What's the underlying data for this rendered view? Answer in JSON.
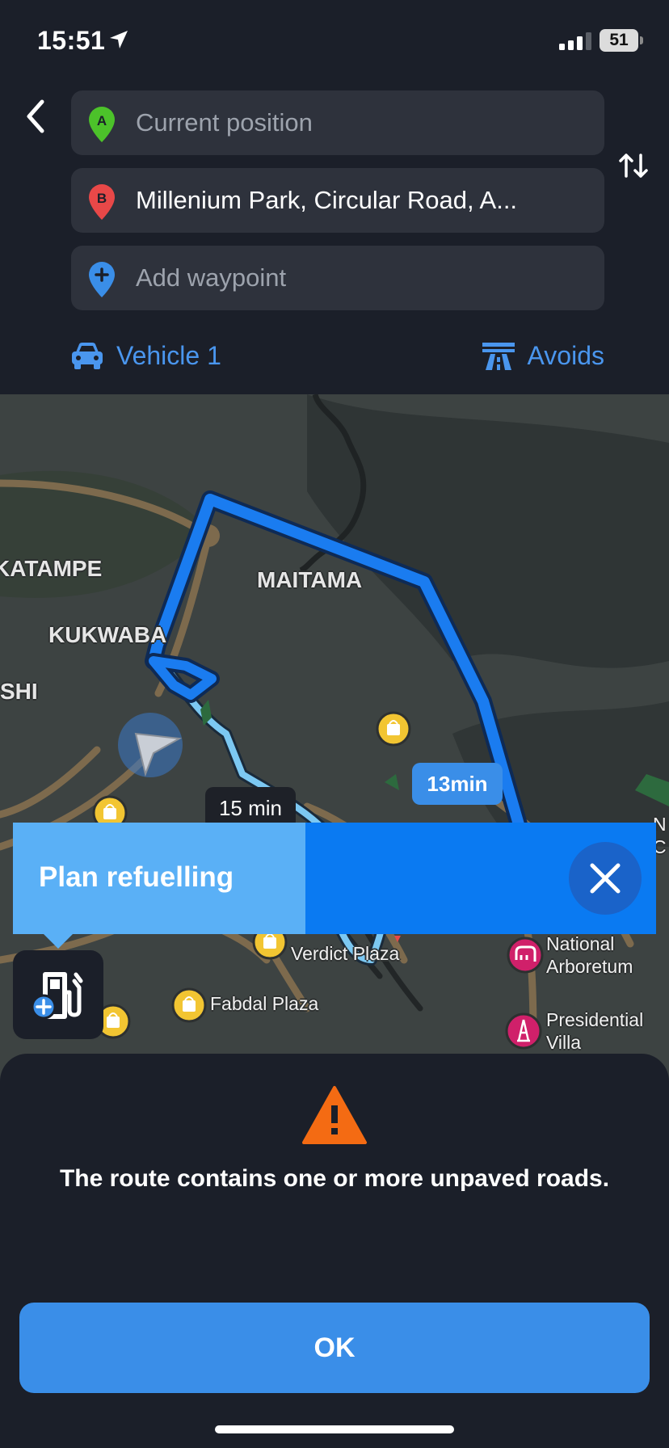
{
  "status_bar": {
    "time": "15:51",
    "battery": "51"
  },
  "route": {
    "origin": {
      "pin_letter": "A",
      "text": "Current position",
      "pin_color": "#4cc22a"
    },
    "destination": {
      "pin_letter": "B",
      "text": "Millenium Park, Circular Road, A...",
      "pin_color": "#e84848"
    },
    "waypoint": {
      "placeholder": "Add waypoint",
      "pin_color": "#3a8ee8"
    }
  },
  "options": {
    "vehicle_label": "Vehicle 1",
    "avoids_label": "Avoids"
  },
  "map": {
    "areas": [
      "KATAMPE",
      "MAITAMA",
      "KUKWABA",
      "SHI"
    ],
    "route_times": {
      "alternative": "15 min",
      "primary": "13min"
    },
    "pois": [
      "Verdict Plaza",
      "National\nArboretum",
      "Fabdal Plaza",
      "Presidential\nVilla"
    ],
    "edge_letters": "N\nC"
  },
  "refuel": {
    "label": "Plan refuelling"
  },
  "sheet": {
    "warning": "The route contains one or more unpaved roads.",
    "ok_label": "OK"
  },
  "colors": {
    "accent": "#3a8ee8",
    "route": "#1a7cf0",
    "warning": "#f46b13",
    "background": "#1b1f29"
  },
  "icons": [
    "location-arrow-icon",
    "signal-icon",
    "battery-icon",
    "back-arrow-icon",
    "swap-icon",
    "car-icon",
    "highway-icon",
    "close-icon",
    "fuel-plus-icon",
    "warning-icon",
    "shopping-bag-icon",
    "elephant-icon",
    "eiffel-icon",
    "navigation-arrow-icon"
  ]
}
